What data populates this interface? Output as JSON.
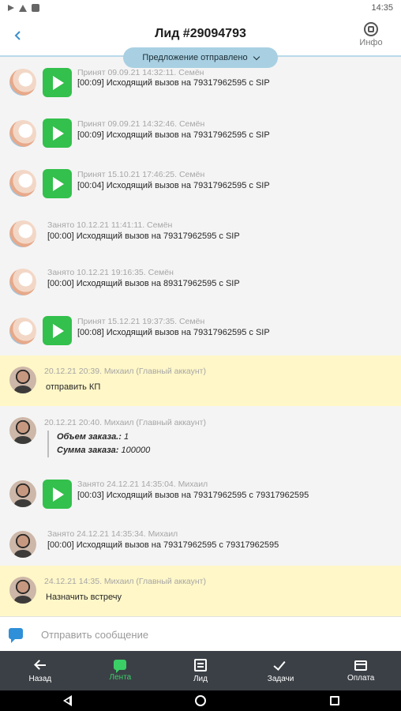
{
  "status_bar": {
    "time": "14:35"
  },
  "header": {
    "title": "Лид #29094793",
    "info_label": "Инфо"
  },
  "offer_pill": {
    "label": "Предложение отправлено"
  },
  "feed": {
    "items": [
      {
        "meta": "Принят 09.09.21 14:32:11. Семён",
        "text": "[00:09] Исходящий вызов на 79317962595 с SIP"
      },
      {
        "meta": "Принят 09.09.21 14:32:46. Семён",
        "text": "[00:09] Исходящий вызов на 79317962595 с SIP"
      },
      {
        "meta": "Принят 15.10.21 17:46:25. Семён",
        "text": "[00:04] Исходящий вызов на 79317962595 с SIP"
      },
      {
        "meta": "Занято 10.12.21 11:41:11. Семён",
        "text": "[00:00] Исходящий вызов на 79317962595 с SIP"
      },
      {
        "meta": "Занято 10.12.21 19:16:35. Семён",
        "text": "[00:00] Исходящий вызов на 89317962595 с SIP"
      },
      {
        "meta": "Принят 15.12.21 19:37:35. Семён",
        "text": "[00:08] Исходящий вызов на 79317962595 с SIP"
      },
      {
        "meta": "20.12.21 20:39. Михаил (Главный аккаунт)",
        "text": "отправить КП"
      },
      {
        "meta": "20.12.21 20:40. Михаил (Главный аккаунт)",
        "quote_line1_label": "Объем заказа.:",
        "quote_line1_value": "1",
        "quote_line2_label": "Сумма заказа:",
        "quote_line2_value": "100000"
      },
      {
        "meta": "Занято 24.12.21 14:35:04. Михаил",
        "text": "[00:03] Исходящий вызов на 79317962595 с 79317962595"
      },
      {
        "meta": "Занято 24.12.21 14:35:34. Михаил",
        "text": "[00:00] Исходящий вызов на 79317962595 с 79317962595"
      },
      {
        "meta": "24.12.21 14:35. Михаил (Главный аккаунт)",
        "text": "Назначить встречу"
      }
    ]
  },
  "composer": {
    "placeholder": "Отправить сообщение"
  },
  "bottom_nav": {
    "back": "Назад",
    "feed": "Лента",
    "lead": "Лид",
    "tasks": "Задачи",
    "payment": "Оплата"
  },
  "colors": {
    "accent": "#33c04c",
    "highlight": "#fff7c8",
    "nav_bg": "#3b4046",
    "pill": "#a8d0e2"
  }
}
